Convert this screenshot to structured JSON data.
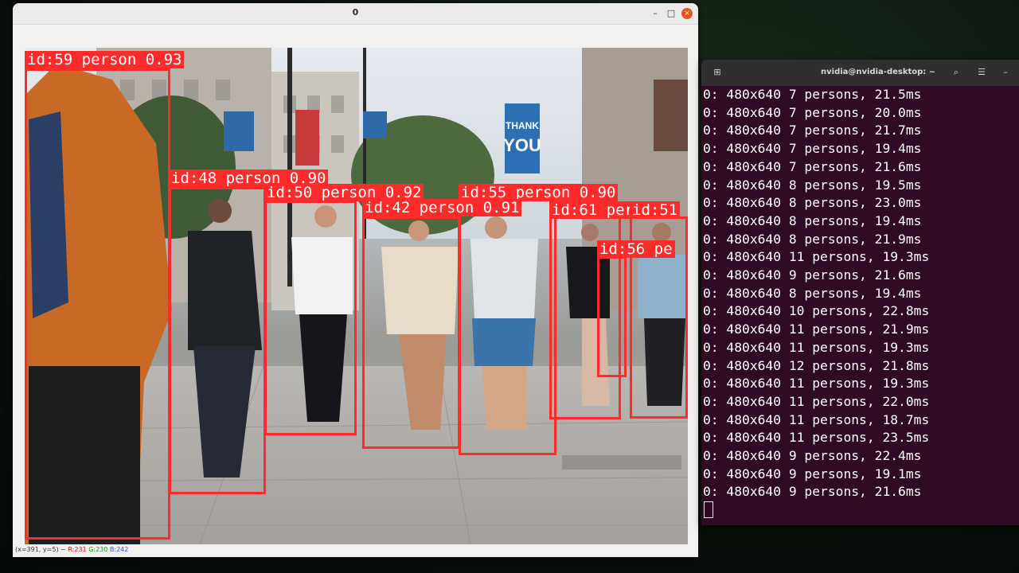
{
  "viewer": {
    "title": "0",
    "controls": {
      "minimize": "–",
      "maximize": "□",
      "close": "×"
    },
    "status": {
      "coords": "(x=391, y=5) ~",
      "r": "R:231",
      "g": "G:230",
      "b": "B:242"
    }
  },
  "detections": [
    {
      "label": "id:59 person 0.93"
    },
    {
      "label": "id:48 person 0.90"
    },
    {
      "label": "id:50 person 0.92"
    },
    {
      "label": "id:55 person 0.90"
    },
    {
      "label": "id:42 person 0.91"
    },
    {
      "label": "id:61 person"
    },
    {
      "label": "id:51"
    },
    {
      "label": "id:56 pe"
    }
  ],
  "scene": {
    "sign_line1": "THANK",
    "sign_line2": "YOU"
  },
  "terminal": {
    "title": "nvidia@nvidia-desktop: ~",
    "icons": [
      "new-tab-icon",
      "search-icon",
      "menu-icon",
      "minimize-icon",
      "close-icon"
    ],
    "lines": [
      "0: 480x640 7 persons, 21.5ms",
      "0: 480x640 7 persons, 20.0ms",
      "0: 480x640 7 persons, 21.7ms",
      "0: 480x640 7 persons, 19.4ms",
      "0: 480x640 7 persons, 21.6ms",
      "0: 480x640 8 persons, 19.5ms",
      "0: 480x640 8 persons, 23.0ms",
      "0: 480x640 8 persons, 19.4ms",
      "0: 480x640 8 persons, 21.9ms",
      "0: 480x640 11 persons, 19.3ms",
      "0: 480x640 9 persons, 21.6ms",
      "0: 480x640 8 persons, 19.4ms",
      "0: 480x640 10 persons, 22.8ms",
      "0: 480x640 11 persons, 21.9ms",
      "0: 480x640 11 persons, 19.3ms",
      "0: 480x640 12 persons, 21.8ms",
      "0: 480x640 11 persons, 19.3ms",
      "0: 480x640 11 persons, 22.0ms",
      "0: 480x640 11 persons, 18.7ms",
      "0: 480x640 11 persons, 23.5ms",
      "0: 480x640 9 persons, 22.4ms",
      "0: 480x640 9 persons, 19.1ms",
      "0: 480x640 9 persons, 21.6ms"
    ]
  },
  "colors": {
    "box": "#ff2a2a",
    "terminal_bg": "#300a24",
    "close_button": "#e95420"
  }
}
